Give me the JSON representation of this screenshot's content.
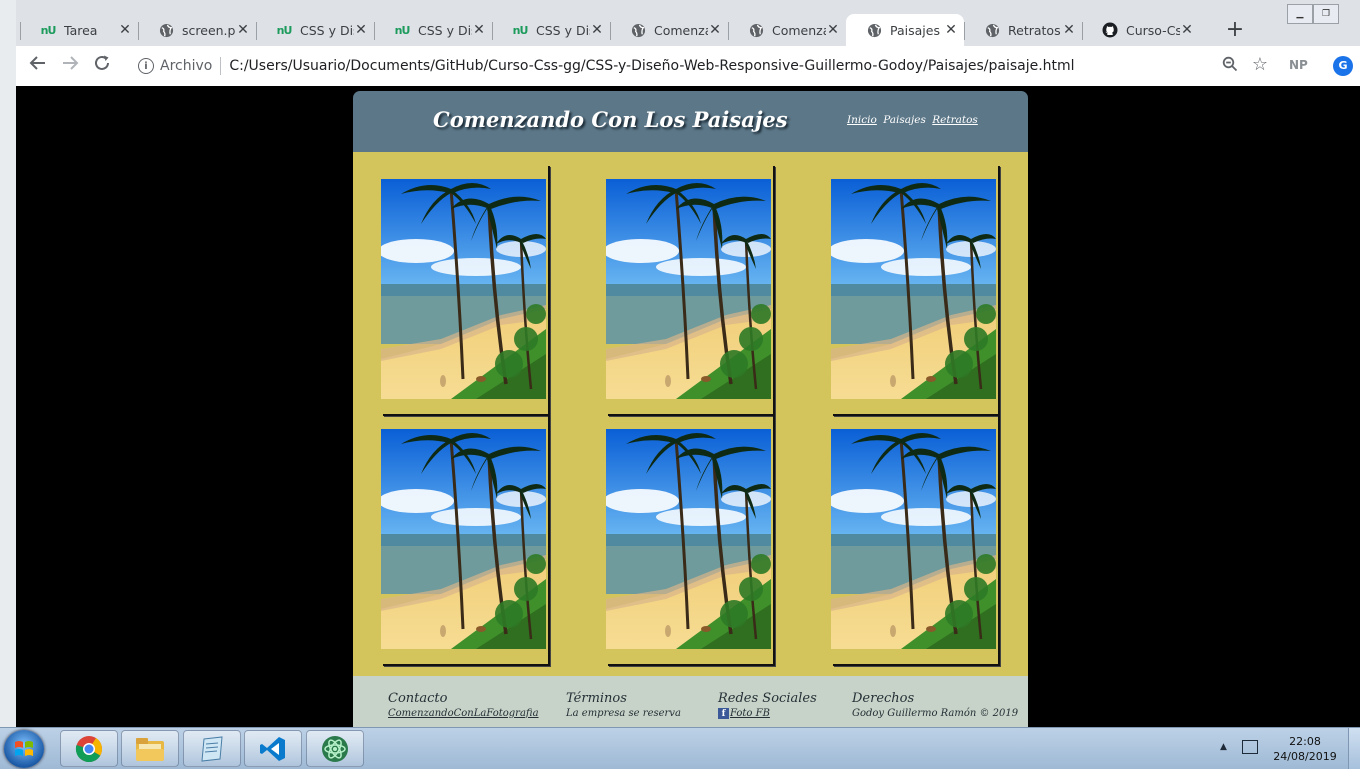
{
  "browser": {
    "tabs": [
      {
        "title": "Tarea",
        "icon": "nu-icon",
        "active": false
      },
      {
        "title": "screen.png",
        "icon": "globe-icon",
        "active": false
      },
      {
        "title": "CSS y Diseño",
        "icon": "nu-icon",
        "active": false
      },
      {
        "title": "CSS y Diseño",
        "icon": "nu-icon",
        "active": false
      },
      {
        "title": "CSS y Diseño",
        "icon": "nu-icon",
        "active": false
      },
      {
        "title": "Comenzando",
        "icon": "globe-icon",
        "active": false
      },
      {
        "title": "Comenzando",
        "icon": "globe-icon",
        "active": false
      },
      {
        "title": "Paisajes",
        "icon": "globe-icon",
        "active": true
      },
      {
        "title": "Retratos",
        "icon": "globe-icon",
        "active": false
      },
      {
        "title": "Curso-Css",
        "icon": "github-icon",
        "active": false
      }
    ],
    "scheme_label": "Archivo",
    "url": "C:/Users/Usuario/Documents/GitHub/Curso-Css-gg/CSS-y-Diseño-Web-Responsive-Guillermo-Godoy/Paisajes/paisaje.html",
    "extension_label": "NP",
    "profile_initial": "G"
  },
  "site": {
    "title": "Comenzando Con Los Paisajes",
    "nav": [
      "Inicio",
      "Paisajes",
      "Retratos"
    ],
    "gallery_count": 6,
    "footer": {
      "contact": {
        "heading": "Contacto",
        "link": "ComenzandoConLaFotografia"
      },
      "terms": {
        "heading": "Términos",
        "text": "La empresa se reserva"
      },
      "social": {
        "heading": "Redes Sociales",
        "link": "Foto FB"
      },
      "rights": {
        "heading": "Derechos",
        "text": "Godoy Guillermo Ramón © 2019"
      }
    }
  },
  "taskbar": {
    "apps": [
      "chrome-icon",
      "file-explorer-icon",
      "notepad-icon",
      "vscode-icon",
      "atom-icon"
    ],
    "time": "22:08",
    "date": "24/08/2019"
  },
  "colors": {
    "header": "#5c7788",
    "gallery_bg": "#d4c45c",
    "footer_bg": "#c7d3c8",
    "page_bg": "#000000"
  }
}
